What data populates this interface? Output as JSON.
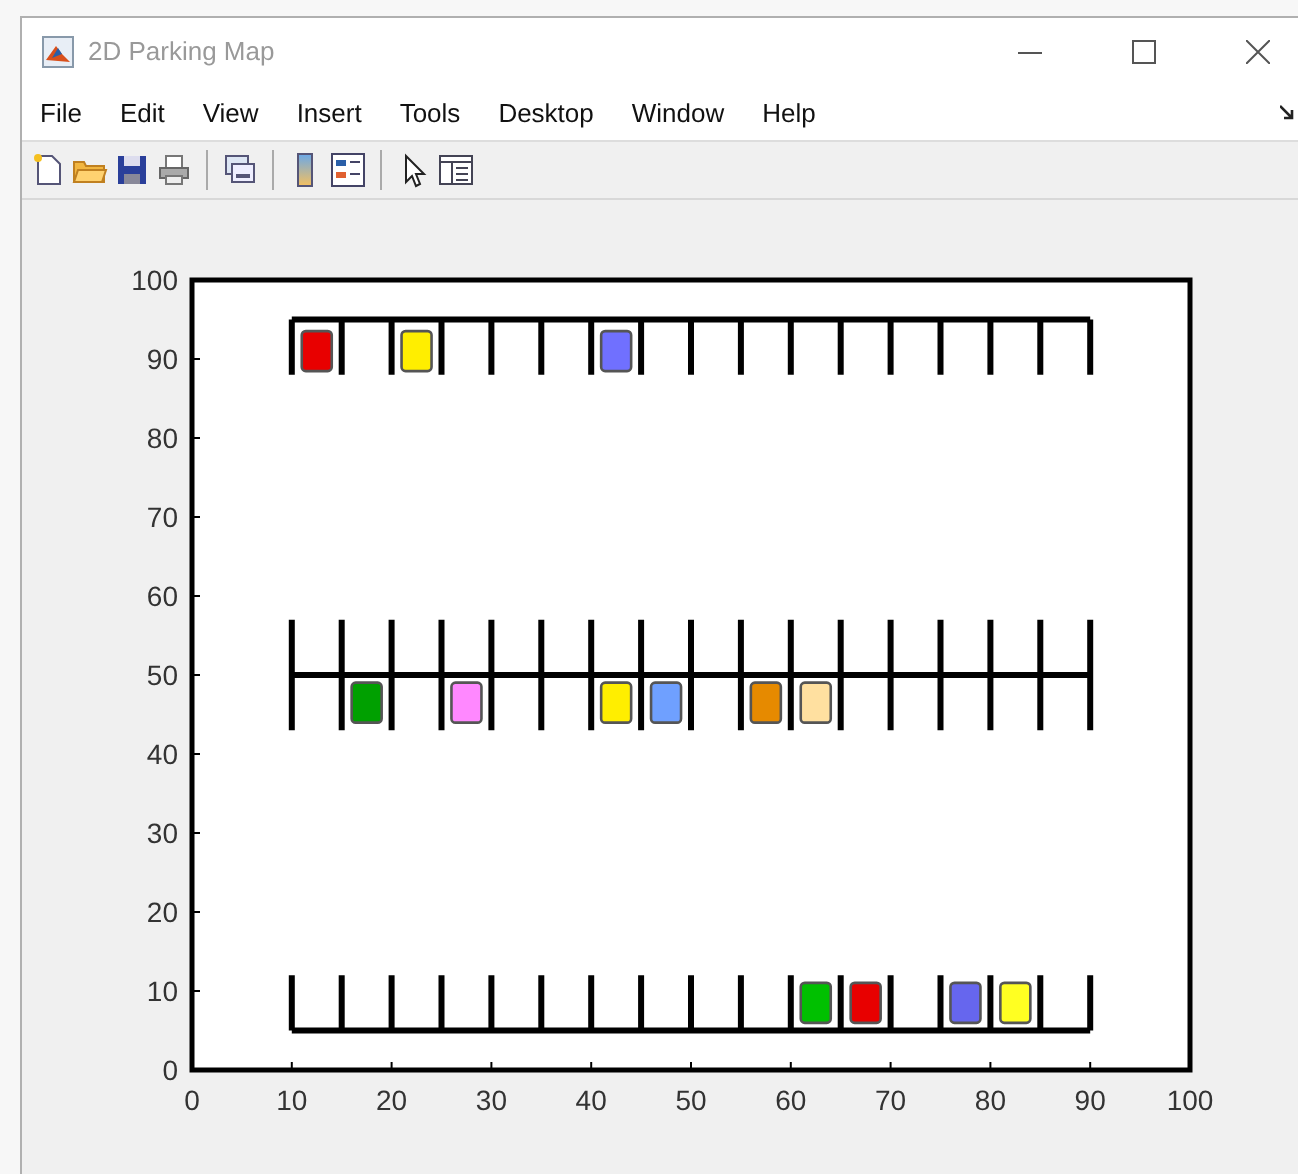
{
  "window": {
    "title": "2D Parking Map"
  },
  "menu": [
    {
      "label": "File"
    },
    {
      "label": "Edit"
    },
    {
      "label": "View"
    },
    {
      "label": "Insert"
    },
    {
      "label": "Tools"
    },
    {
      "label": "Desktop"
    },
    {
      "label": "Window"
    },
    {
      "label": "Help"
    }
  ],
  "plot": {
    "chart_data": {
      "type": "scatter",
      "xlim": [
        0,
        100
      ],
      "ylim": [
        0,
        100
      ],
      "xticks": [
        {
          "value": 0,
          "label": "0"
        },
        {
          "value": 10,
          "label": "10"
        },
        {
          "value": 20,
          "label": "20"
        },
        {
          "value": 30,
          "label": "30"
        },
        {
          "value": 40,
          "label": "40"
        },
        {
          "value": 50,
          "label": "50"
        },
        {
          "value": 60,
          "label": "60"
        },
        {
          "value": 70,
          "label": "70"
        },
        {
          "value": 80,
          "label": "80"
        },
        {
          "value": 90,
          "label": "90"
        },
        {
          "value": 100,
          "label": "100"
        }
      ],
      "yticks": [
        {
          "value": 0,
          "label": "0"
        },
        {
          "value": 10,
          "label": "10"
        },
        {
          "value": 20,
          "label": "20"
        },
        {
          "value": 30,
          "label": "30"
        },
        {
          "value": 40,
          "label": "40"
        },
        {
          "value": 50,
          "label": "50"
        },
        {
          "value": 60,
          "label": "60"
        },
        {
          "value": 70,
          "label": "70"
        },
        {
          "value": 80,
          "label": "80"
        },
        {
          "value": 90,
          "label": "90"
        },
        {
          "value": 100,
          "label": "100"
        }
      ],
      "x": [
        12.5,
        22.5,
        42.5,
        17.5,
        27.5,
        42.5,
        47.5,
        57.5,
        62.5,
        62.5,
        67.5,
        77.5,
        82.5
      ],
      "series": [
        {
          "values": [
            91,
            91,
            91,
            46.5,
            46.5,
            46.5,
            46.5,
            46.5,
            46.5,
            8.5,
            8.5,
            8.5,
            8.5
          ]
        }
      ]
    },
    "cars": [
      {
        "color": "#e80000"
      },
      {
        "color": "#ffee00"
      },
      {
        "color": "#7070ff"
      },
      {
        "color": "#00a000"
      },
      {
        "color": "#ff88ff"
      },
      {
        "color": "#ffee00"
      },
      {
        "color": "#6fa0ff"
      },
      {
        "color": "#e68a00"
      },
      {
        "color": "#ffe0a0"
      },
      {
        "color": "#00c000"
      },
      {
        "color": "#e80000"
      },
      {
        "color": "#6666ee"
      },
      {
        "color": "#ffff22"
      }
    ]
  }
}
